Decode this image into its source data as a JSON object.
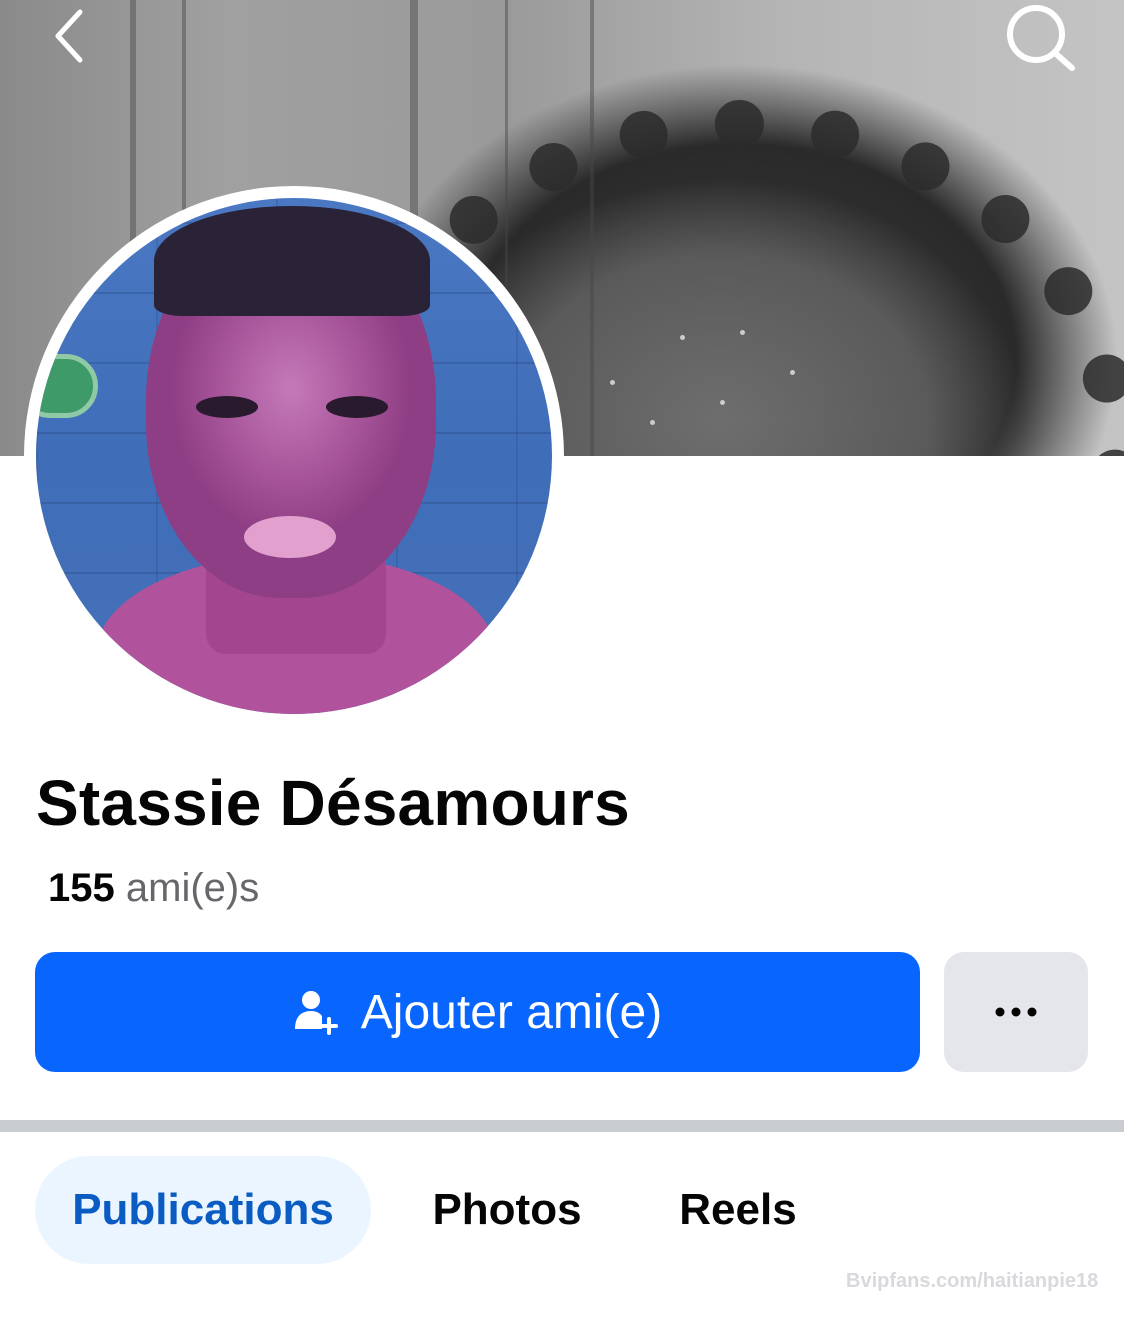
{
  "header": {
    "back_icon": "chevron-left-icon",
    "search_icon": "search-icon"
  },
  "profile": {
    "name": "Stassie Désamours",
    "friends_count": "155",
    "friends_label": "ami(e)s"
  },
  "actions": {
    "add_friend_label": "Ajouter ami(e)",
    "add_friend_icon": "person-add-icon",
    "more_icon": "ellipsis-icon"
  },
  "tabs": [
    {
      "label": "Publications",
      "active": true
    },
    {
      "label": "Photos",
      "active": false
    },
    {
      "label": "Reels",
      "active": false
    }
  ],
  "watermark": "Bvipfans.com/haitianpie18",
  "colors": {
    "primary": "#0866ff",
    "active_tab_bg": "#ebf5ff",
    "active_tab_text": "#0a5cc2",
    "secondary_button": "#e4e6eb"
  }
}
